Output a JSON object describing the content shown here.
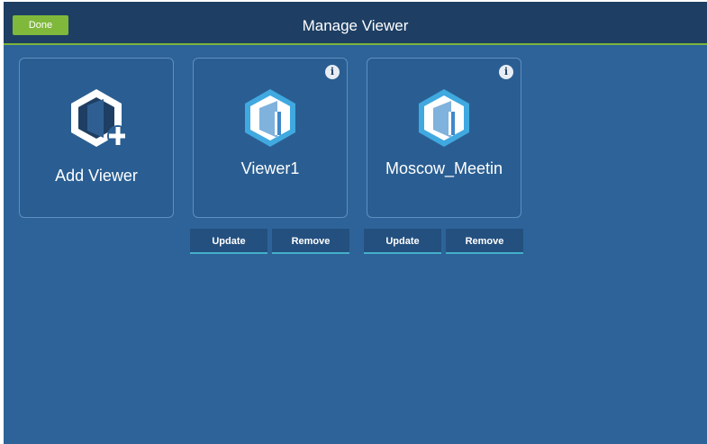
{
  "header": {
    "done_label": "Done",
    "title": "Manage Viewer"
  },
  "add_card": {
    "label": "Add Viewer",
    "icon": "viewer-add-icon"
  },
  "viewers": [
    {
      "name": "Viewer1",
      "icon": "viewer-icon",
      "info_glyph": "i",
      "update_label": "Update",
      "remove_label": "Remove"
    },
    {
      "name": "Moscow_Meetin",
      "icon": "viewer-icon",
      "info_glyph": "i",
      "update_label": "Update",
      "remove_label": "Remove"
    }
  ],
  "colors": {
    "background": "#2d6399",
    "header": "#1e3f63",
    "done_button": "#7fb83b",
    "header_accent": "#7db33a",
    "button_underline": "#44b0c9",
    "icon_blue": "#3fa9e0"
  }
}
